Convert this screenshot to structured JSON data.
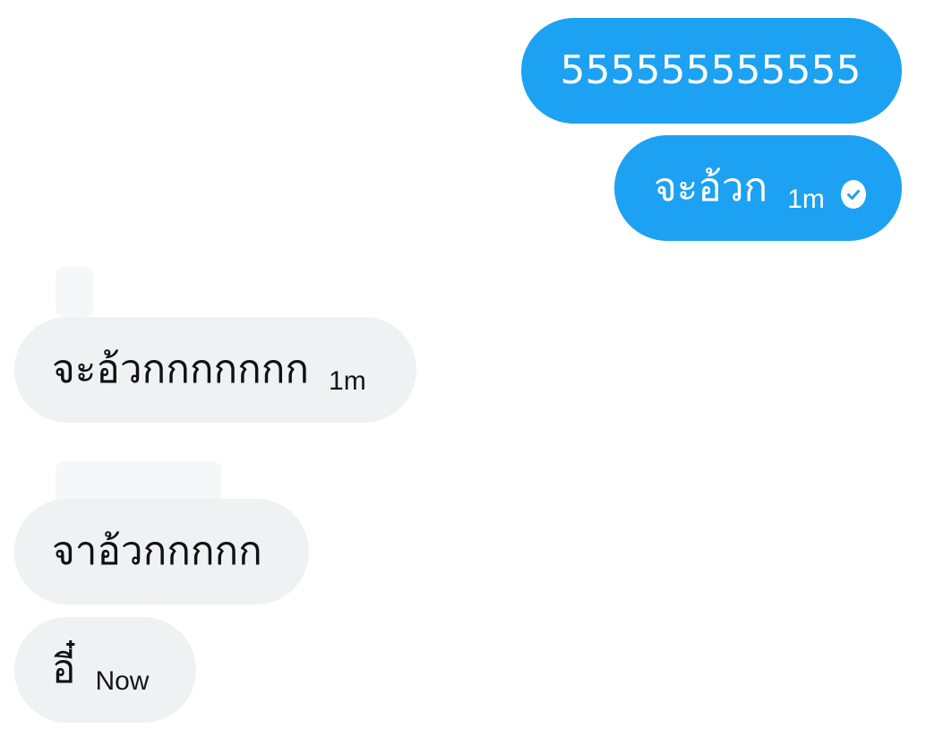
{
  "conversation": {
    "messages": [
      {
        "direction": "sent",
        "text": "555555555555",
        "time": ""
      },
      {
        "direction": "sent",
        "text": "จะอ้วก",
        "time": "1m",
        "status": "read-check-icon"
      },
      {
        "direction": "received",
        "text": "จะอ้วกกกกกกก",
        "time": "1m"
      },
      {
        "direction": "received",
        "text": "จาอ้วกกกกก",
        "time": ""
      },
      {
        "direction": "received",
        "text": "อี๋",
        "time": "Now"
      }
    ]
  },
  "colors": {
    "sent_bubble": "#1da1f2",
    "received_bubble": "#eff1f3",
    "sent_text": "#ffffff",
    "received_text": "#111111"
  }
}
